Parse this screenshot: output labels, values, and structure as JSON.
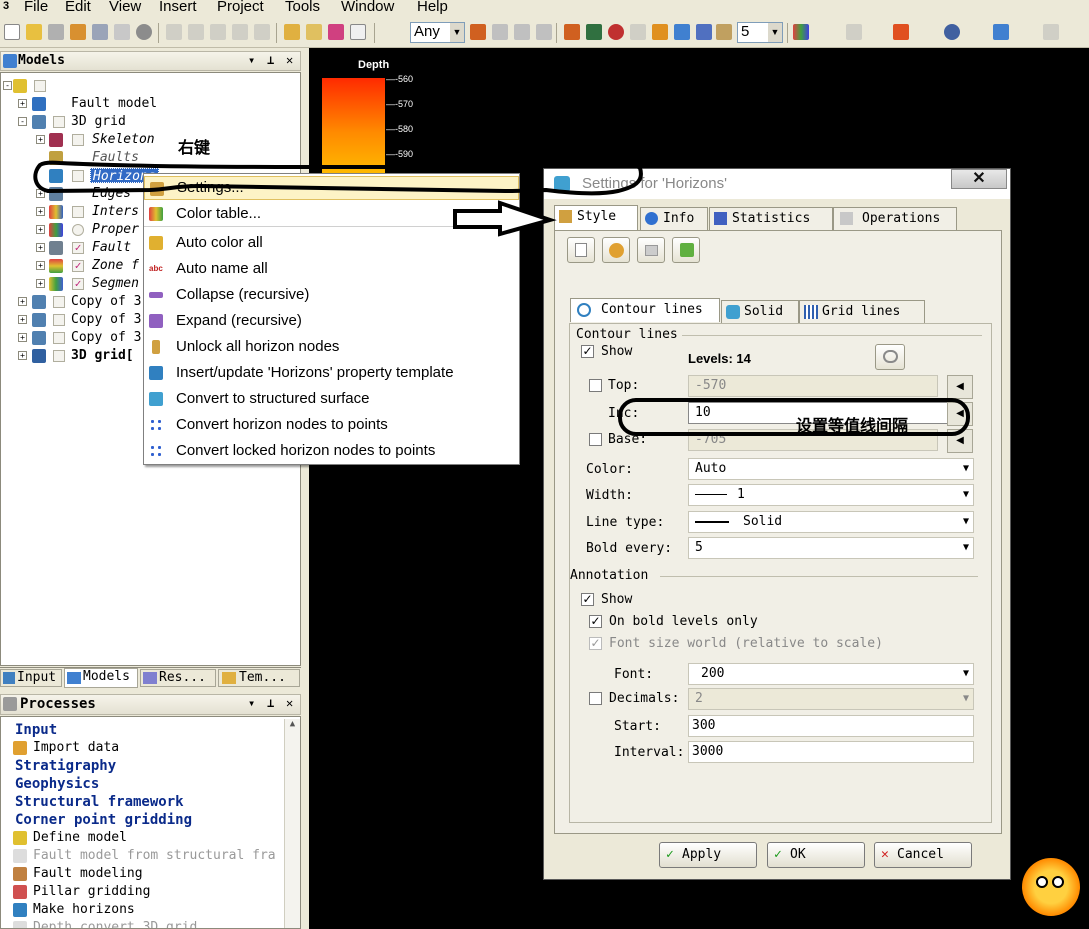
{
  "menubar": {
    "app_badge": "3",
    "items": [
      "File",
      "Edit",
      "View",
      "Insert",
      "Project",
      "Tools",
      "Window",
      "Help"
    ]
  },
  "toolbar": {
    "combo_any": "Any",
    "combo_number": "5"
  },
  "models_panel": {
    "title": "Models",
    "tree": [
      {
        "label": "",
        "italic": false
      },
      {
        "label": "Fault model"
      },
      {
        "label": "3D grid"
      },
      {
        "label": "Skeleton"
      },
      {
        "label": "Faults"
      },
      {
        "label": "Horizons"
      },
      {
        "label": "Edges"
      },
      {
        "label": "Inters"
      },
      {
        "label": "Proper"
      },
      {
        "label": "Fault"
      },
      {
        "label": "Zone f"
      },
      {
        "label": "Segmen"
      },
      {
        "label": "Copy of 3"
      },
      {
        "label": "Copy of 3"
      },
      {
        "label": "Copy of 3"
      },
      {
        "label": "3D grid["
      }
    ],
    "tabs": [
      "Input",
      "Models",
      "Res...",
      "Tem..."
    ]
  },
  "processes_panel": {
    "title": "Processes",
    "items": [
      {
        "label": "Input",
        "kind": "group"
      },
      {
        "label": "Import data",
        "kind": "item"
      },
      {
        "label": "Stratigraphy",
        "kind": "group"
      },
      {
        "label": "Geophysics",
        "kind": "group"
      },
      {
        "label": "Structural framework",
        "kind": "group"
      },
      {
        "label": "Corner point gridding",
        "kind": "group"
      },
      {
        "label": "Define model",
        "kind": "item"
      },
      {
        "label": "Fault model from structural fra",
        "kind": "disabled"
      },
      {
        "label": "Fault modeling",
        "kind": "item"
      },
      {
        "label": "Pillar gridding",
        "kind": "item"
      },
      {
        "label": "Make horizons",
        "kind": "item"
      },
      {
        "label": "Depth convert 3D grid",
        "kind": "disabled"
      }
    ]
  },
  "colorbar": {
    "title": "Depth",
    "ticks": [
      "-560",
      "-570",
      "-580",
      "-590"
    ],
    "colors": [
      "#ff2a00",
      "#ff8a00",
      "#ffd500"
    ]
  },
  "annotations": {
    "right_click": "右键",
    "set_contour_interval": "设置等值线间隔"
  },
  "context_menu": {
    "items": [
      "Settings...",
      "Color table...",
      "Auto color all",
      "Auto name all",
      "Collapse (recursive)",
      "Expand (recursive)",
      "Unlock all horizon nodes",
      "Insert/update 'Horizons' property template",
      "Convert to structured surface",
      "Convert horizon nodes to points",
      "Convert locked horizon nodes to points"
    ]
  },
  "dialog": {
    "title": "Settings for 'Horizons'",
    "tabs": [
      "Style",
      "Info",
      "Statistics",
      "Operations"
    ],
    "subtabs": [
      "Contour lines",
      "Solid",
      "Grid lines"
    ],
    "contour_section": "Contour lines",
    "show_label": "Show",
    "levels_text": "Levels: 14",
    "top_label": "Top:",
    "top_value": "-570",
    "inc_label": "Inc:",
    "inc_value": "10",
    "base_label": "Base:",
    "base_value": "-705",
    "color_label": "Color:",
    "color_value": "Auto",
    "width_label": "Width:",
    "width_value": "1",
    "linetype_label": "Line type:",
    "linetype_value": "Solid",
    "bold_every_label": "Bold every:",
    "bold_every_value": "5",
    "annotation_section": "Annotation",
    "annot_show_label": "Show",
    "on_bold_label": "On bold levels only",
    "font_size_world_label": "Font size world (relative to scale)",
    "font_label": "Font:",
    "font_value": "200",
    "decimals_label": "Decimals:",
    "decimals_value": "2",
    "start_label": "Start:",
    "start_value": "300",
    "interval_label": "Interval:",
    "interval_value": "3000",
    "apply": "Apply",
    "ok": "OK",
    "cancel": "Cancel"
  }
}
